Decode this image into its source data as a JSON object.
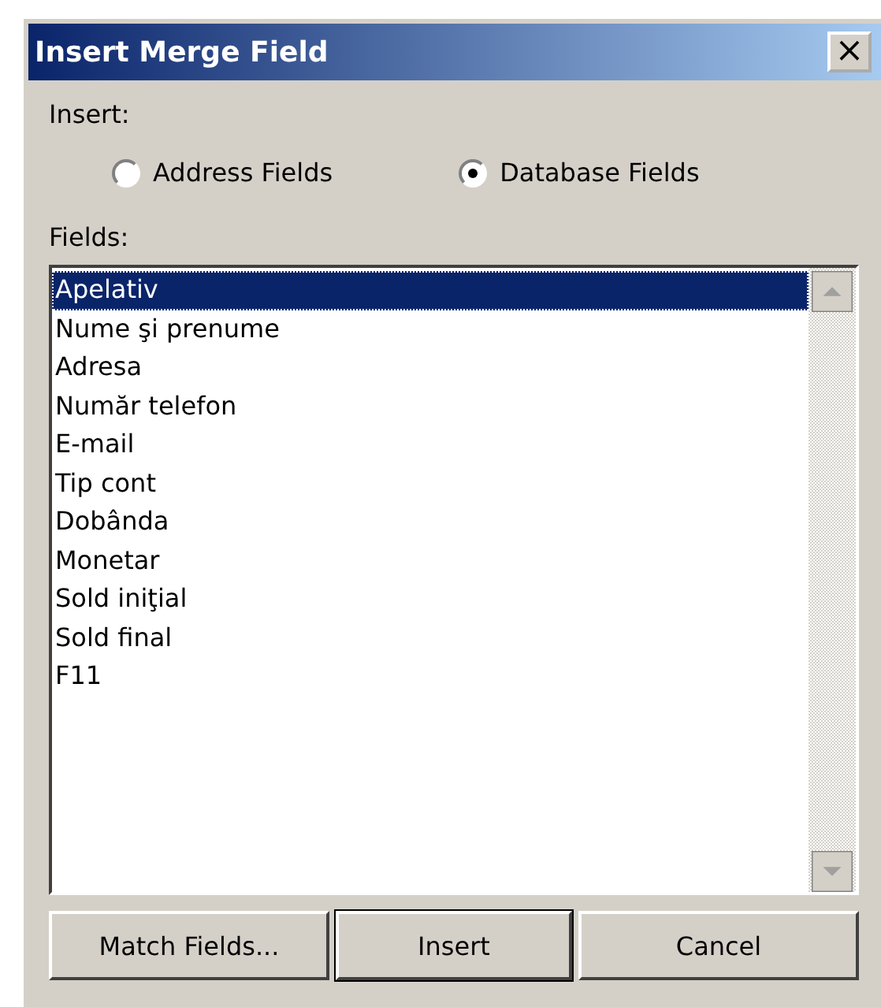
{
  "window": {
    "title": "Insert Merge Field",
    "close": "×"
  },
  "insert": {
    "label": "Insert:",
    "options": [
      {
        "label": "Address Fields",
        "selected": false
      },
      {
        "label": "Database Fields",
        "selected": true
      }
    ]
  },
  "fields": {
    "label": "Fields:",
    "items": [
      {
        "label": "Apelativ",
        "selected": true
      },
      {
        "label": "Nume şi prenume",
        "selected": false
      },
      {
        "label": "Adresa",
        "selected": false
      },
      {
        "label": "Număr telefon",
        "selected": false
      },
      {
        "label": "E-mail",
        "selected": false
      },
      {
        "label": "Tip cont",
        "selected": false
      },
      {
        "label": "Dobânda",
        "selected": false
      },
      {
        "label": "Monetar",
        "selected": false
      },
      {
        "label": "Sold iniţial",
        "selected": false
      },
      {
        "label": "Sold final",
        "selected": false
      },
      {
        "label": "F11",
        "selected": false
      }
    ]
  },
  "buttons": [
    {
      "label": "Match Fields...",
      "default": false
    },
    {
      "label": "Insert",
      "default": true
    },
    {
      "label": "Cancel",
      "default": false
    }
  ]
}
